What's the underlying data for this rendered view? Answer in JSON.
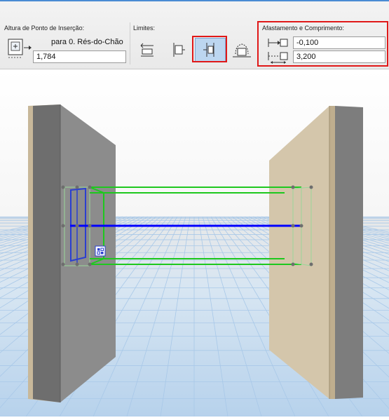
{
  "toolbar": {
    "insertion_height": {
      "label": "Altura de Ponto de Inserção:",
      "reference": "para 0. Rés-do-Chão",
      "value": "1,784"
    },
    "limits": {
      "label": "Limites:",
      "buttons": [
        "limit-left-icon",
        "limit-center-icon",
        "limit-both-icon",
        "limit-custom-icon"
      ],
      "active_index": 2
    },
    "offset_length": {
      "label": "Afastamento e Comprimento:",
      "offset_value": "-0,100",
      "length_value": "3,200"
    }
  },
  "colors": {
    "accent_blue": "#0000ff",
    "guide_green": "#1ec81e",
    "highlight_red": "#e01818",
    "left_wall": "#8c8c8c",
    "right_wall": "#d4c6ab",
    "floor_grid": "#a8c8e8"
  }
}
